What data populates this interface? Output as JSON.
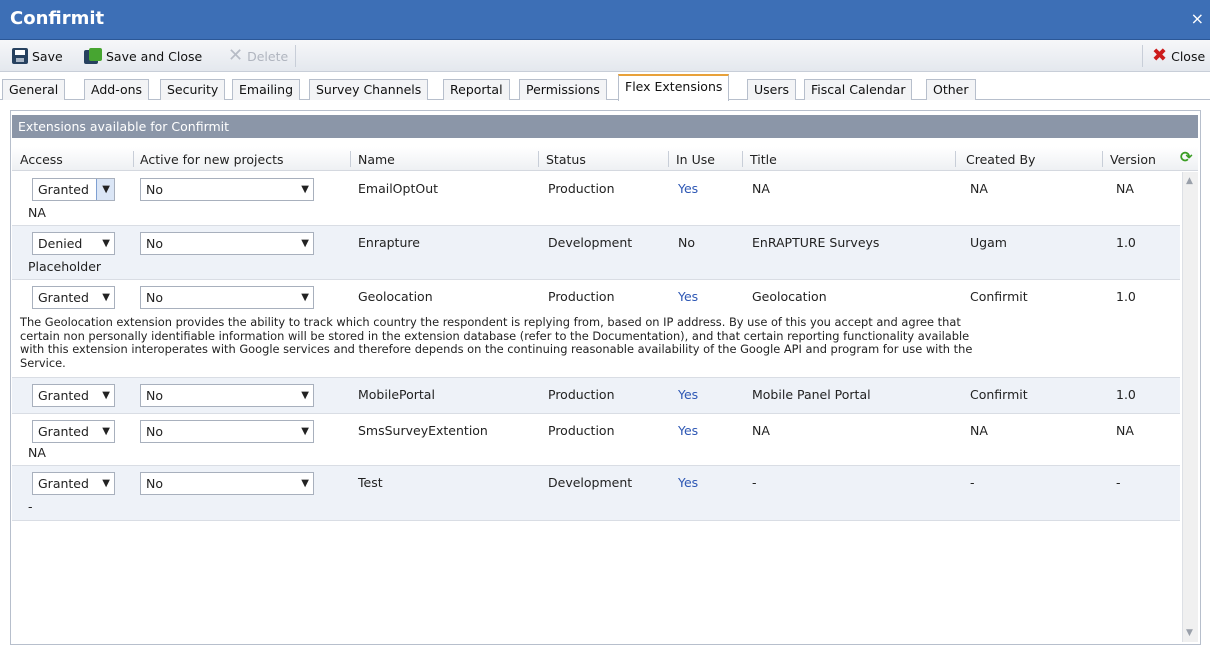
{
  "window": {
    "title": "Confirmit",
    "close_glyph": "×"
  },
  "toolbar": {
    "save": "Save",
    "save_close": "Save and Close",
    "delete": "Delete",
    "close": "Close"
  },
  "tabs": [
    "General",
    "Add-ons",
    "Security",
    "Emailing",
    "Survey Channels",
    "Reportal",
    "Permissions",
    "Flex Extensions",
    "Users",
    "Fiscal Calendar",
    "Other"
  ],
  "active_tab": "Flex Extensions",
  "panel": {
    "heading": "Extensions available for Confirmit"
  },
  "columns": {
    "access": "Access",
    "active": "Active for new projects",
    "name": "Name",
    "status": "Status",
    "inuse": "In Use",
    "title": "Title",
    "created": "Created By",
    "version": "Version"
  },
  "rows": [
    {
      "access": "Granted",
      "active": "No",
      "name": "EmailOptOut",
      "status": "Production",
      "inuse": "Yes",
      "title": "NA",
      "created": "NA",
      "version": "NA",
      "description": "NA"
    },
    {
      "access": "Denied",
      "active": "No",
      "name": "Enrapture",
      "status": "Development",
      "inuse": "No",
      "title": "EnRAPTURE Surveys",
      "created": "Ugam",
      "version": "1.0",
      "description": "Placeholder"
    },
    {
      "access": "Granted",
      "active": "No",
      "name": "Geolocation",
      "status": "Production",
      "inuse": "Yes",
      "title": "Geolocation",
      "created": "Confirmit",
      "version": "1.0",
      "description_lines": [
        "The Geolocation extension provides the ability to track which country the respondent is replying from, based on IP address. By use of this you accept and agree that",
        "certain non personally identifiable information will be stored in the extension database (refer to the Documentation), and that certain reporting functionality available",
        "with this extension interoperates with Google services and therefore depends on the continuing reasonable availability of the Google API and program for use with the",
        "Service."
      ]
    },
    {
      "access": "Granted",
      "active": "No",
      "name": "MobilePortal",
      "status": "Production",
      "inuse": "Yes",
      "title": "Mobile Panel Portal",
      "created": "Confirmit",
      "version": "1.0"
    },
    {
      "access": "Granted",
      "active": "No",
      "name": "SmsSurveyExtention",
      "status": "Production",
      "inuse": "Yes",
      "title": "NA",
      "created": "NA",
      "version": "NA",
      "description": "NA"
    },
    {
      "access": "Granted",
      "active": "No",
      "name": "Test",
      "status": "Development",
      "inuse": "Yes",
      "title": "-",
      "created": "-",
      "version": "-",
      "description": "-"
    }
  ],
  "colors": {
    "titlebar": "#3d6fb6",
    "panel_heading": "#8b96a8",
    "link": "#2d57b4",
    "tab_accent": "#e8a13a"
  }
}
